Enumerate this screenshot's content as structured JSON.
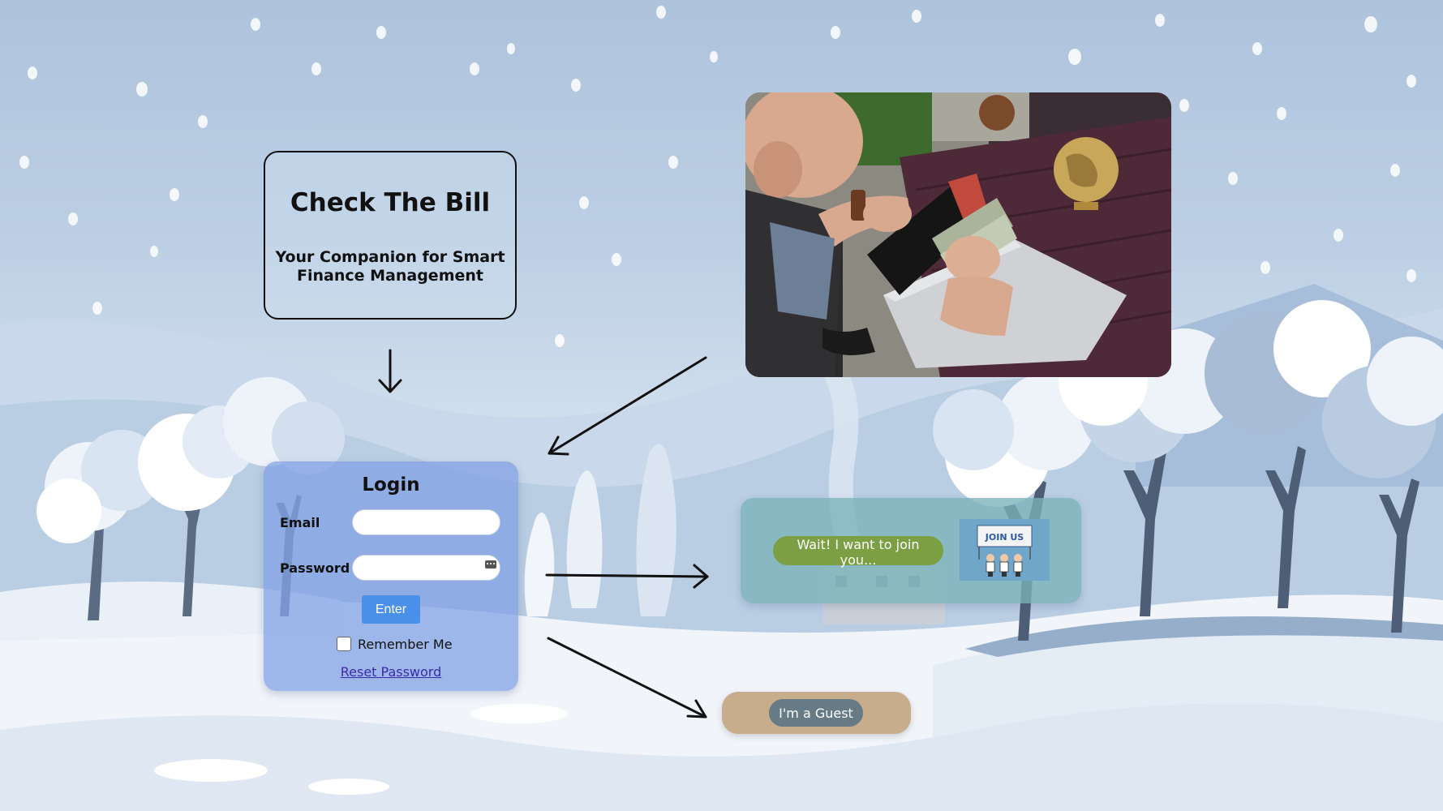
{
  "title_card": {
    "title": "Check The Bill",
    "subtitle": "Your Companion for Smart Finance Management"
  },
  "hero_image": {
    "icon": "wallet-cash-photo"
  },
  "login": {
    "title": "Login",
    "email_label": "Email",
    "email_value": "",
    "password_label": "Password",
    "password_value": "",
    "enter_label": "Enter",
    "remember_label": "Remember Me",
    "remember_checked": false,
    "reset_label": "Reset Password"
  },
  "join": {
    "button_label": "Wait! I want to join you...",
    "banner_text": "JOIN US"
  },
  "guest": {
    "button_label": "I'm a Guest"
  },
  "colors": {
    "login_card": "#7ea0e4",
    "enter_button": "#4a90e8",
    "join_card": "#7ab2b8",
    "join_button": "#7c9f43",
    "guest_card": "#c7ad8c",
    "guest_button": "#667b86"
  }
}
